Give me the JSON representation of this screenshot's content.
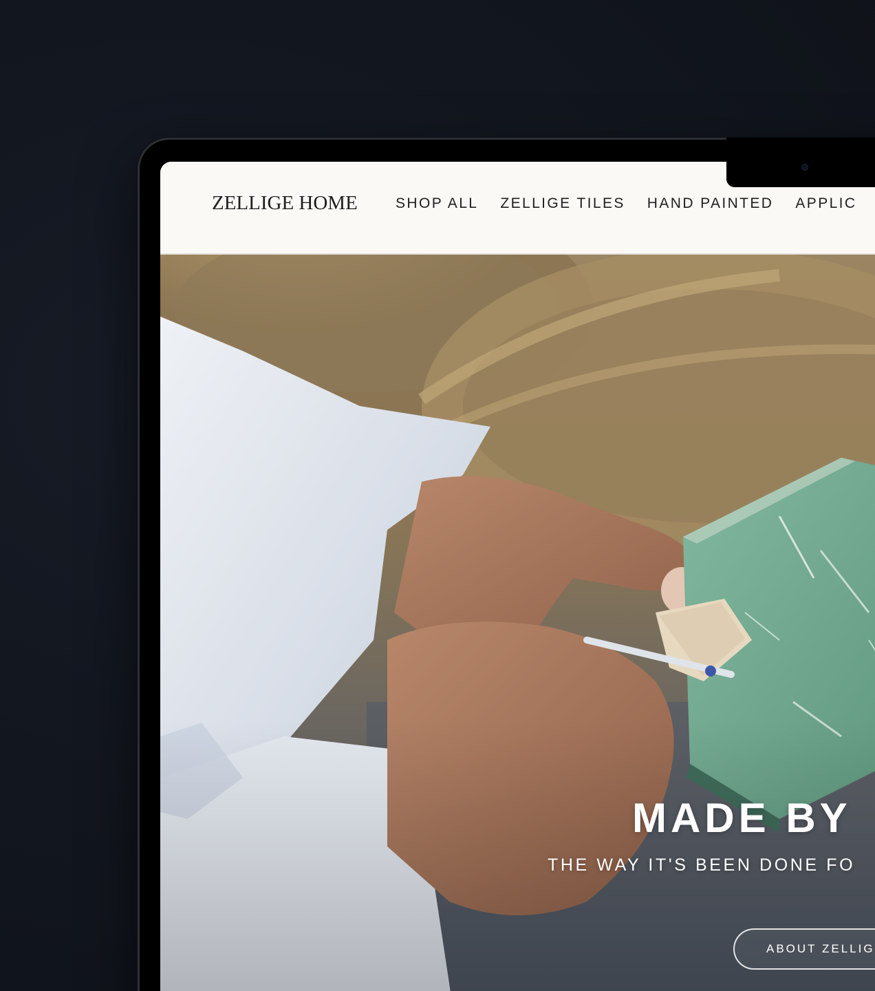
{
  "site": {
    "logo": "ZELLIGE HOME",
    "nav": [
      {
        "label": "SHOP ALL"
      },
      {
        "label": "ZELLIGE TILES"
      },
      {
        "label": "HAND PAINTED"
      },
      {
        "label": "APPLIC"
      }
    ]
  },
  "hero": {
    "title": "MADE BY",
    "subtitle": "THE WAY IT'S BEEN DONE FO",
    "button_label": "ABOUT ZELLIG"
  },
  "colors": {
    "page_background": "#11151d",
    "header_background": "#faf9f6",
    "text_dark": "#1e1e1e",
    "hero_text": "#ffffff",
    "tile_green": "#6fa88f"
  }
}
